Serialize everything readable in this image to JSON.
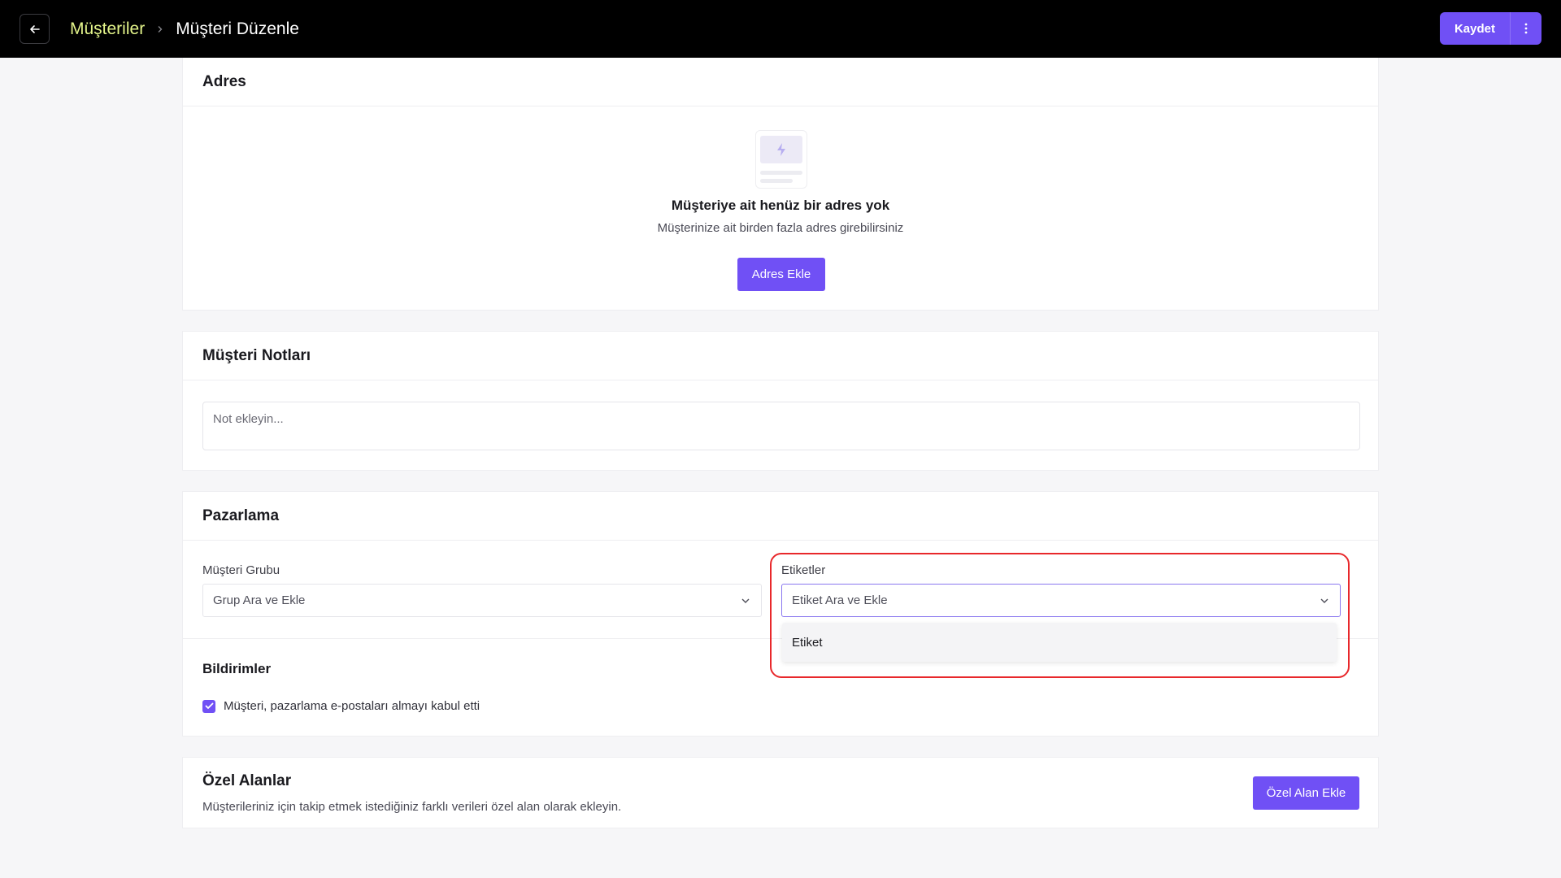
{
  "header": {
    "breadcrumb_parent": "Müşteriler",
    "page_title": "Müşteri Düzenle",
    "save_label": "Kaydet"
  },
  "address": {
    "title": "Adres",
    "empty_title": "Müşteriye ait henüz bir adres yok",
    "empty_subtitle": "Müşterinize ait birden fazla adres girebilirsiniz",
    "add_button": "Adres Ekle"
  },
  "notes": {
    "title": "Müşteri Notları",
    "placeholder": "Not ekleyin..."
  },
  "marketing": {
    "title": "Pazarlama",
    "group_label": "Müşteri Grubu",
    "group_placeholder": "Grup Ara ve Ekle",
    "tags_label": "Etiketler",
    "tags_placeholder": "Etiket Ara ve Ekle",
    "tags_options": [
      "Etiket"
    ],
    "notifications_title": "Bildirimler",
    "email_consent_label": "Müşteri, pazarlama e-postaları almayı kabul etti",
    "email_consent_checked": true
  },
  "custom_fields": {
    "title": "Özel Alanlar",
    "subtitle": "Müşterileriniz için takip etmek istediğiniz farklı verileri özel alan olarak ekleyin.",
    "add_button": "Özel Alan Ekle"
  },
  "colors": {
    "accent": "#7050f5",
    "breadcrumb_parent": "#e3f48a",
    "header_bg": "#000000",
    "highlight": "#e8282b"
  }
}
